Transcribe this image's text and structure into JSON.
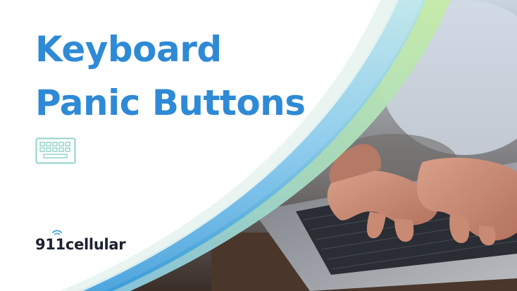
{
  "title": {
    "line1": "Keyboard",
    "line2": "Panic Buttons"
  },
  "brand": {
    "name": "911cellular"
  },
  "icons": {
    "keyboard": "keyboard-icon",
    "signal": "wifi-signal-icon"
  },
  "colors": {
    "title": "#2f8ad6",
    "brand_text": "#1b2230",
    "swoosh_green": "#b7e39a",
    "swoosh_blue": "#3fa3de",
    "icon_stroke": "#8fd3c7"
  }
}
